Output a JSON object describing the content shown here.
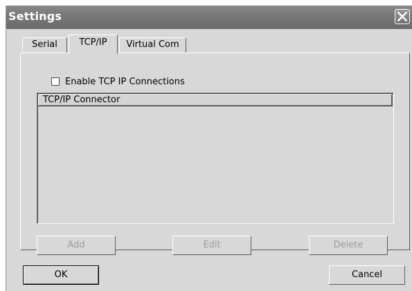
{
  "window": {
    "title": "Settings",
    "close_icon": "close-x-icon"
  },
  "tabs": [
    {
      "label": "Serial",
      "active": false
    },
    {
      "label": "TCP/IP",
      "active": true
    },
    {
      "label": "Virtual Com",
      "active": false
    }
  ],
  "tcpip_panel": {
    "enable_checkbox": {
      "label": "Enable TCP IP Connections",
      "checked": false
    },
    "list": {
      "columns": [
        "TCP/IP Connector"
      ],
      "rows": []
    },
    "buttons": {
      "add": {
        "label": "Add",
        "enabled": false
      },
      "edit": {
        "label": "Edit",
        "enabled": false
      },
      "delete": {
        "label": "Delete",
        "enabled": false
      }
    }
  },
  "footer": {
    "ok_label": "OK",
    "cancel_label": "Cancel"
  },
  "colors": {
    "title_bar": "#767676",
    "dialog_face": "#d8d8d8",
    "disabled_text": "#9c9c9c"
  }
}
